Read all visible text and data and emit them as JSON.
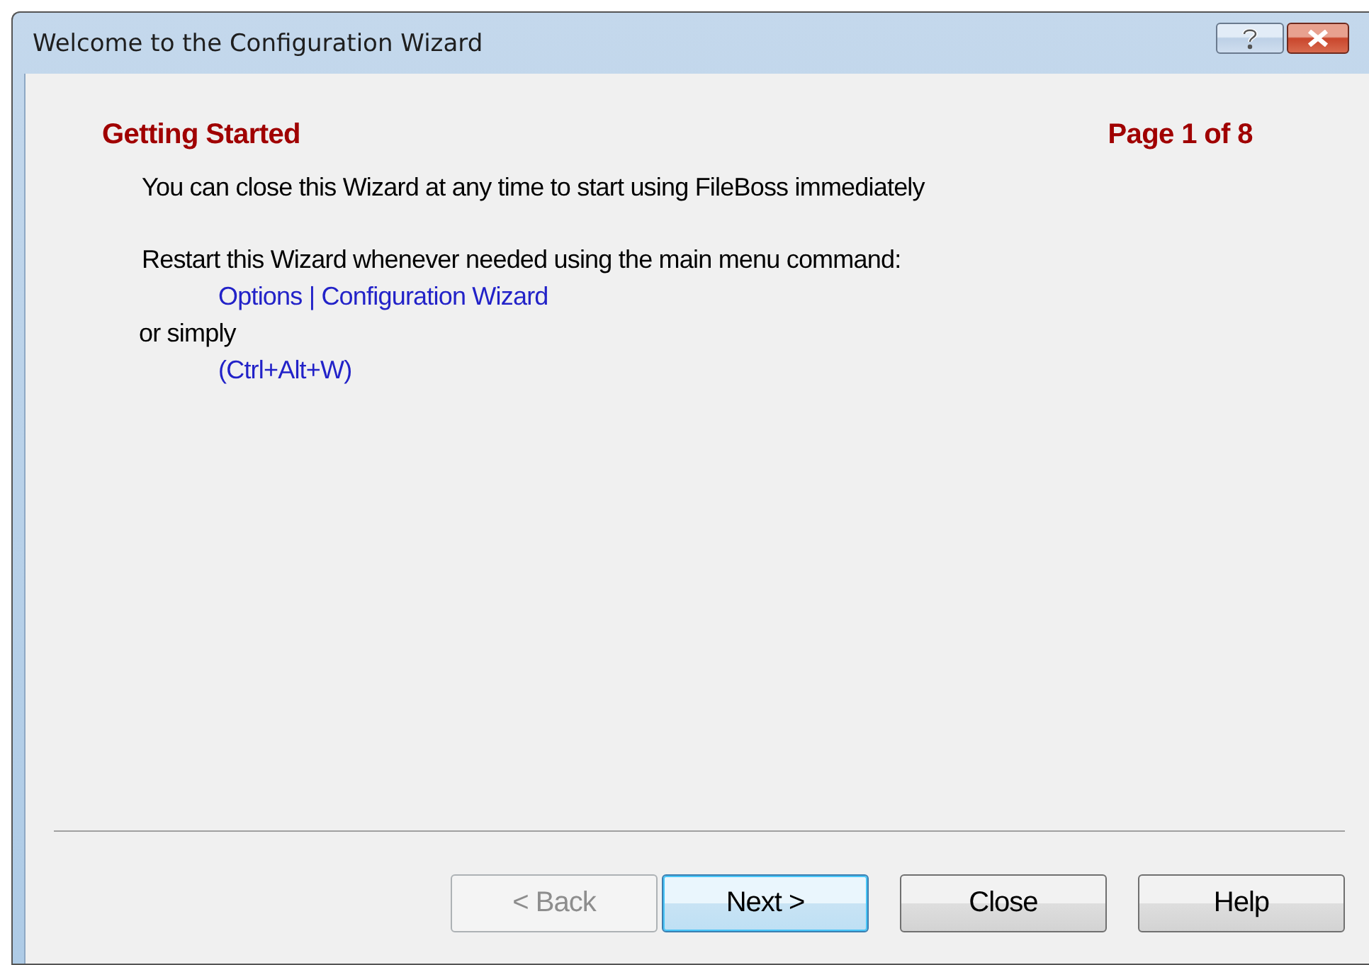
{
  "window": {
    "title": "Welcome to the Configuration Wizard"
  },
  "page": {
    "heading": "Getting Started",
    "page_indicator": "Page 1 of 8"
  },
  "lines": [
    {
      "kind": "text",
      "text": "You can close this Wizard at any time to start using FileBoss immediately"
    },
    {
      "kind": "gap"
    },
    {
      "kind": "text",
      "text": "Restart this Wizard whenever needed using the main menu command:"
    },
    {
      "kind": "command",
      "text": "Options | Configuration Wizard"
    },
    {
      "kind": "outdent",
      "text": "or simply"
    },
    {
      "kind": "command",
      "text": "(Ctrl+Alt+W)"
    }
  ],
  "buttons": [
    {
      "label": "< Back",
      "disabled": true,
      "default": false
    },
    {
      "label": "Next >",
      "disabled": false,
      "default": true
    },
    {
      "label": "Close",
      "disabled": false,
      "default": false
    },
    {
      "label": "Help",
      "disabled": false,
      "default": false
    }
  ]
}
